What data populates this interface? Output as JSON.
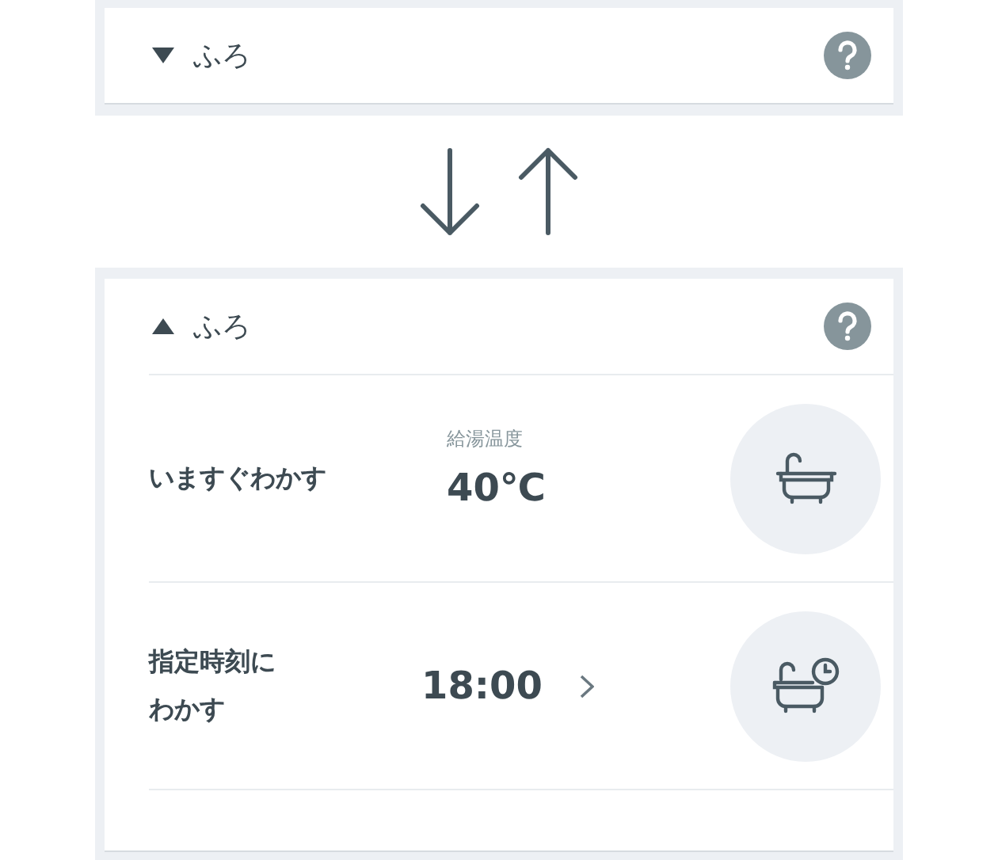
{
  "panels": [
    {
      "title": "ふろ",
      "expanded": false
    },
    {
      "title": "ふろ",
      "expanded": true,
      "rows": [
        {
          "kind": "now",
          "label": "いますぐわかす",
          "caption": "給湯温度",
          "value": "40℃"
        },
        {
          "kind": "timer",
          "label": "指定時刻にわかす",
          "value": "18:00"
        }
      ]
    }
  ]
}
